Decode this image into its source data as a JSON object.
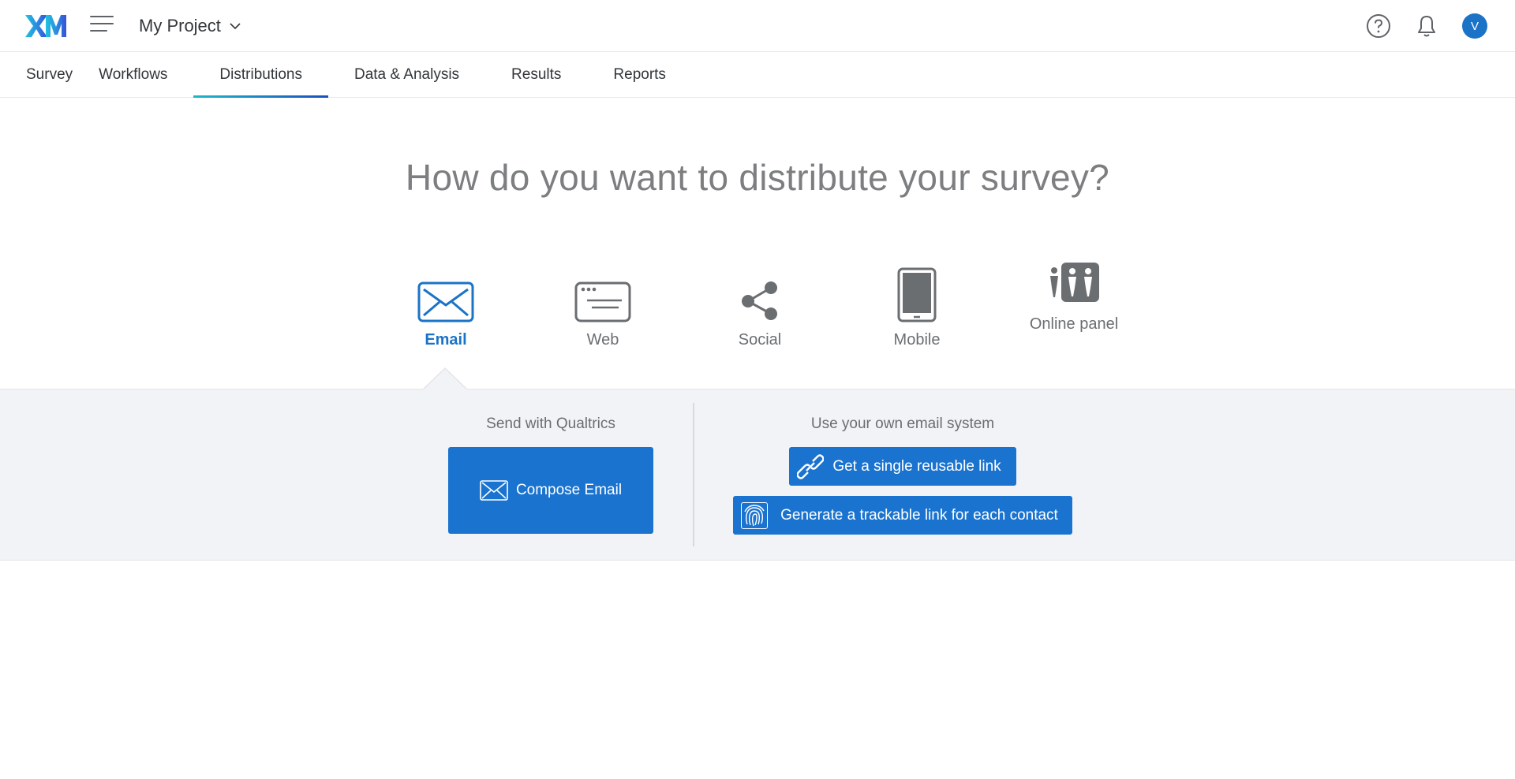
{
  "app": {
    "logo_text": "XM",
    "project_name": "My Project",
    "avatar_initial": "V"
  },
  "tabs": [
    {
      "label": "Survey",
      "active": false
    },
    {
      "label": "Workflows",
      "active": false
    },
    {
      "label": "Distributions",
      "active": true
    },
    {
      "label": "Data & Analysis",
      "active": false
    },
    {
      "label": "Results",
      "active": false
    },
    {
      "label": "Reports",
      "active": false
    }
  ],
  "main": {
    "heading": "How do you want to distribute your survey?",
    "methods": [
      {
        "label": "Email",
        "icon": "envelope-icon",
        "active": true
      },
      {
        "label": "Web",
        "icon": "web-browser-icon",
        "active": false
      },
      {
        "label": "Social",
        "icon": "share-icon",
        "active": false
      },
      {
        "label": "Mobile",
        "icon": "tablet-icon",
        "active": false
      },
      {
        "label": "Online panel",
        "icon": "people-icon",
        "active": false
      }
    ]
  },
  "panel": {
    "left_title": "Send with Qualtrics",
    "compose_label": "Compose Email",
    "right_title": "Use your own email system",
    "reusable_link_label": "Get a single reusable link",
    "trackable_link_label": "Generate a trackable link for each contact"
  },
  "colors": {
    "accent": "#1a73cf",
    "active_text": "#1a73c7",
    "panel_bg": "#f1f3f6",
    "heading": "#7c7e80"
  }
}
